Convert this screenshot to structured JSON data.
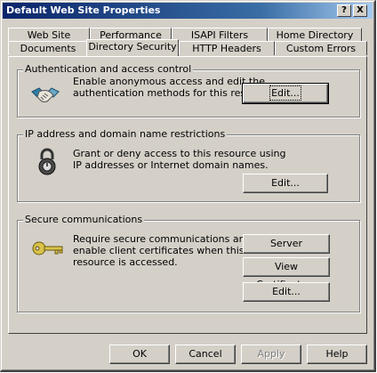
{
  "window": {
    "title": "Default Web Site Properties",
    "help_button": "?",
    "close_button": "X"
  },
  "tabs": {
    "back_row": [
      "Web Site",
      "Performance",
      "ISAPI Filters",
      "Home Directory"
    ],
    "front_row": [
      "Documents",
      "Directory Security",
      "HTTP Headers",
      "Custom Errors"
    ],
    "active": "Directory Security"
  },
  "auth": {
    "legend": "Authentication and access control",
    "line1": "Enable anonymous access and edit the",
    "line2": "authentication methods for this resource.",
    "edit": "Edit...",
    "icon": "handshake-icon"
  },
  "ip": {
    "legend": "IP address and domain name restrictions",
    "line1": "Grant or deny access to this resource using",
    "line2": "IP addresses or Internet domain names.",
    "edit": "Edit...",
    "icon": "padlock-icon"
  },
  "secure": {
    "legend": "Secure communications",
    "line1": "Require secure communications and",
    "line2": "enable client certificates when this",
    "line3": "resource is accessed.",
    "server_cert": "Server Certificate...",
    "view_cert": "View Certificate...",
    "edit": "Edit...",
    "icon": "key-icon"
  },
  "footer": {
    "ok": "OK",
    "cancel": "Cancel",
    "apply": "Apply",
    "help": "Help"
  }
}
